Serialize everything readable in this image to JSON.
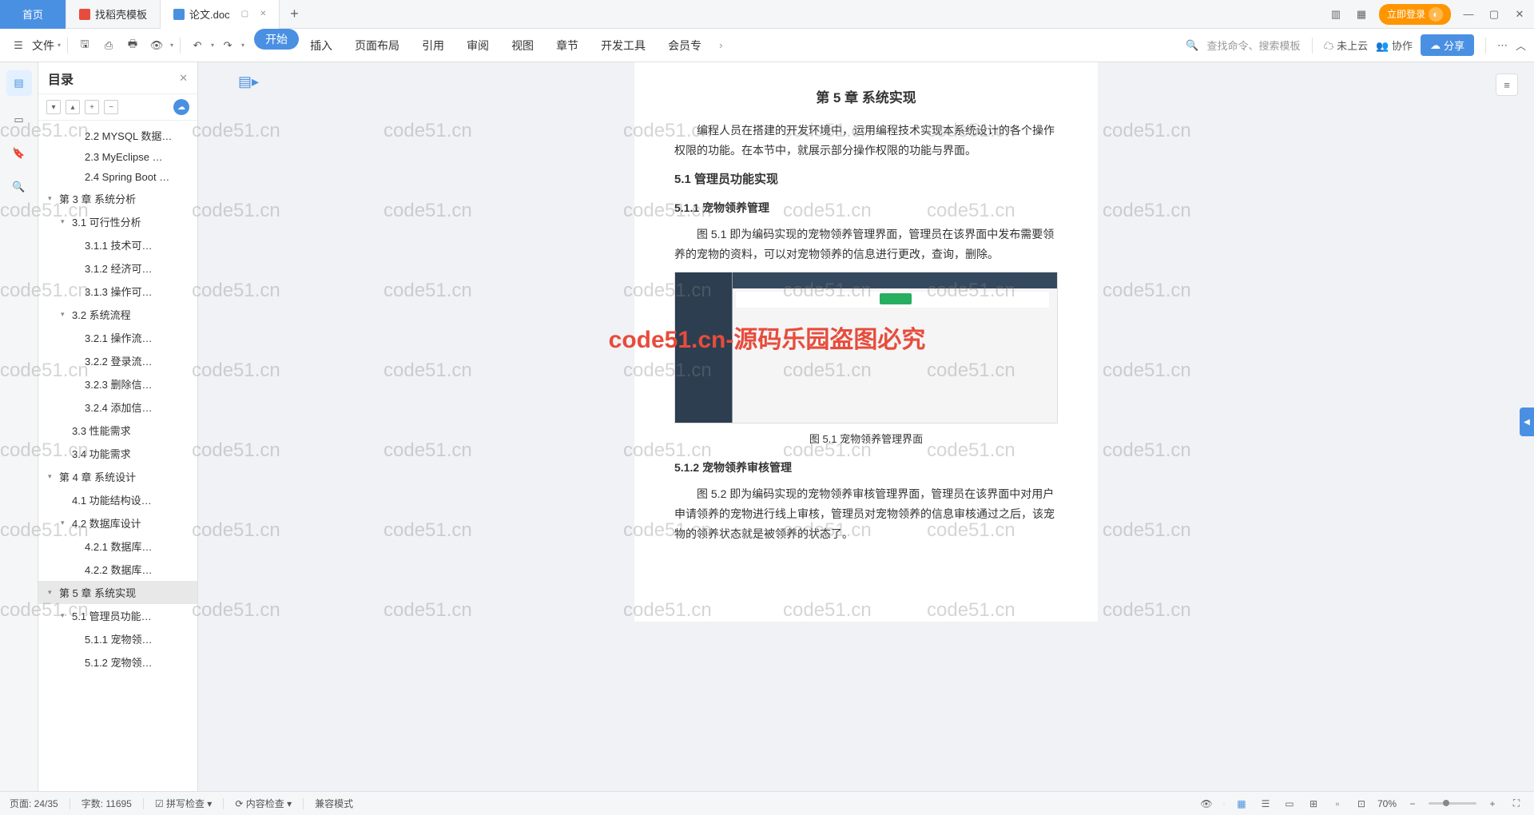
{
  "titlebar": {
    "home": "首页",
    "tab1": "找稻壳模板",
    "tab2": "论文.doc",
    "login": "立即登录"
  },
  "ribbon": {
    "file": "文件",
    "tabs": [
      "开始",
      "插入",
      "页面布局",
      "引用",
      "审阅",
      "视图",
      "章节",
      "开发工具",
      "会员专"
    ],
    "search": "查找命令、搜索模板",
    "cloud": "未上云",
    "coop": "协作",
    "share": "分享"
  },
  "outline": {
    "title": "目录",
    "items": [
      {
        "lvl": 3,
        "t": "2.2 MYSQL 数据…"
      },
      {
        "lvl": 3,
        "t": "2.3 MyEclipse …"
      },
      {
        "lvl": 3,
        "t": "2.4 Spring Boot …"
      },
      {
        "lvl": 1,
        "t": "第 3 章  系统分析",
        "exp": true
      },
      {
        "lvl": 2,
        "t": "3.1 可行性分析",
        "exp": true
      },
      {
        "lvl": 3,
        "t": "3.1.1 技术可…"
      },
      {
        "lvl": 3,
        "t": "3.1.2 经济可…"
      },
      {
        "lvl": 3,
        "t": "3.1.3 操作可…"
      },
      {
        "lvl": 2,
        "t": "3.2 系统流程",
        "exp": true
      },
      {
        "lvl": 3,
        "t": "3.2.1 操作流…"
      },
      {
        "lvl": 3,
        "t": "3.2.2 登录流…"
      },
      {
        "lvl": 3,
        "t": "3.2.3 删除信…"
      },
      {
        "lvl": 3,
        "t": "3.2.4 添加信…"
      },
      {
        "lvl": 2,
        "t": "3.3 性能需求"
      },
      {
        "lvl": 2,
        "t": "3.4 功能需求"
      },
      {
        "lvl": 1,
        "t": "第 4 章  系统设计",
        "exp": true
      },
      {
        "lvl": 2,
        "t": "4.1 功能结构设…"
      },
      {
        "lvl": 2,
        "t": "4.2 数据库设计",
        "exp": true
      },
      {
        "lvl": 3,
        "t": "4.2.1 数据库…"
      },
      {
        "lvl": 3,
        "t": "4.2.2 数据库…"
      },
      {
        "lvl": 1,
        "t": "第 5 章  系统实现",
        "exp": true,
        "sel": true
      },
      {
        "lvl": 2,
        "t": "5.1 管理员功能…",
        "exp": true
      },
      {
        "lvl": 3,
        "t": "5.1.1 宠物领…"
      },
      {
        "lvl": 3,
        "t": "5.1.2 宠物领…"
      }
    ]
  },
  "doc": {
    "h2": "第 5 章  系统实现",
    "intro": "编程人员在搭建的开发环境中，运用编程技术实现本系统设计的各个操作权限的功能。在本节中，就展示部分操作权限的功能与界面。",
    "h3_1": "5.1  管理员功能实现",
    "h4_1": "5.1.1  宠物领养管理",
    "p1": "图 5.1 即为编码实现的宠物领养管理界面，管理员在该界面中发布需要领养的宠物的资料，可以对宠物领养的信息进行更改，查询，删除。",
    "cap1": "图 5.1 宠物领养管理界面",
    "h4_2": "5.1.2  宠物领养审核管理",
    "p2": "图 5.2 即为编码实现的宠物领养审核管理界面，管理员在该界面中对用户申请领养的宠物进行线上审核，管理员对宠物领养的信息审核通过之后，该宠物的领养状态就是被领养的状态了。"
  },
  "watermark_text": "code51.cn",
  "center_mark": "code51.cn-源码乐园盗图必究",
  "statusbar": {
    "page": "页面: 24/35",
    "words": "字数: 11695",
    "spell": "拼写检查",
    "content": "内容检查",
    "compat": "兼容模式",
    "zoom": "70%"
  }
}
